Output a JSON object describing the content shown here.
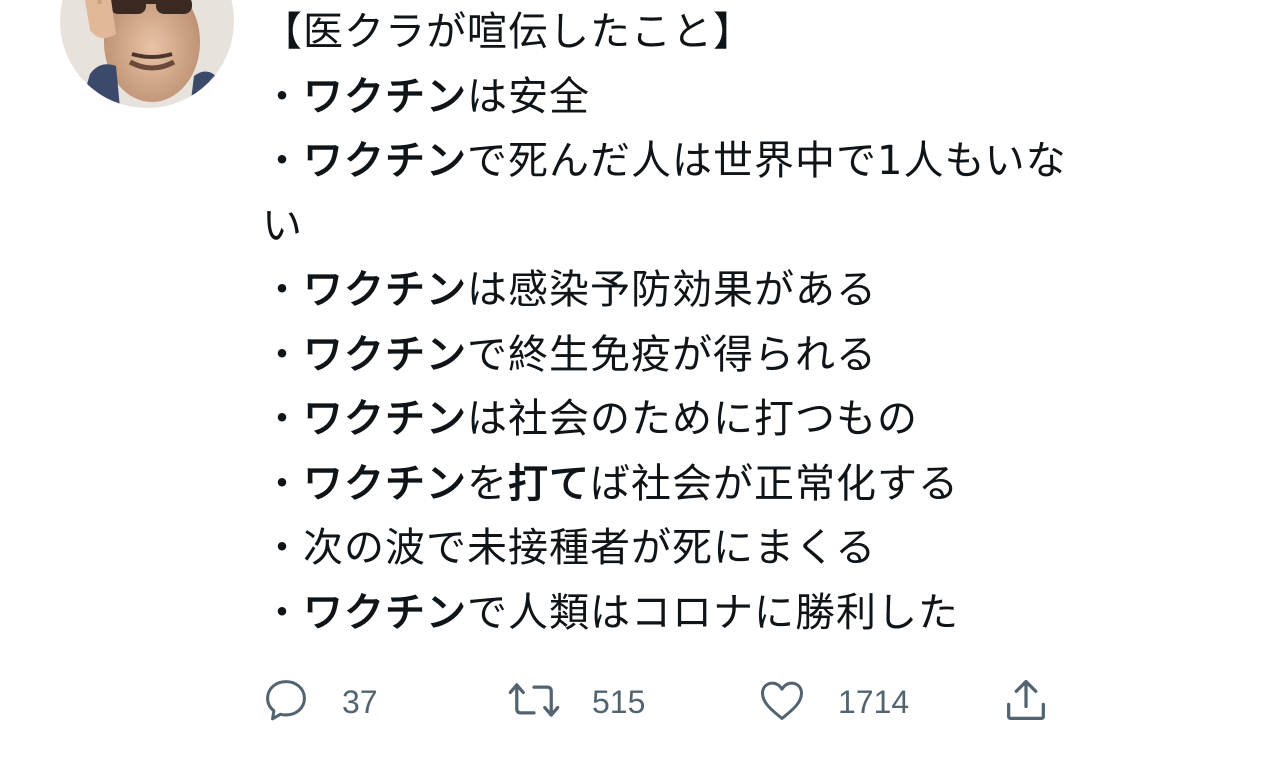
{
  "tweet": {
    "lines": [
      {
        "bullet": "",
        "bold": "",
        "text": "【医クラが喧伝したこと】"
      },
      {
        "bullet": "・",
        "bold": "ワクチン",
        "text": "は安全"
      },
      {
        "bullet": "・",
        "bold": "ワクチン",
        "text": "で死んだ人は世界中で1人もいな"
      },
      {
        "bullet": "",
        "bold": "",
        "text": "い"
      },
      {
        "bullet": "・",
        "bold": "ワクチン",
        "text": "は感染予防効果がある"
      },
      {
        "bullet": "・",
        "bold": "ワクチン",
        "text": "で終生免疫が得られる"
      },
      {
        "bullet": "・",
        "bold": "ワクチン",
        "text": "は社会のために打つもの"
      },
      {
        "bullet": "・",
        "bold": "ワクチン",
        "text": "を",
        "bold2": "打て",
        "text2": "ば社会が正常化する"
      },
      {
        "bullet": "・",
        "bold": "",
        "text": "次の波で未接種者が死にまくる"
      },
      {
        "bullet": "・",
        "bold": "ワクチン",
        "text": "で人類はコロナに勝利した"
      }
    ]
  },
  "actions": {
    "reply_count": "37",
    "retweet_count": "515",
    "like_count": "1714",
    "icons": {
      "reply": "reply-icon",
      "retweet": "retweet-icon",
      "like": "heart-icon",
      "share": "share-icon"
    },
    "icon_color": "#536471"
  }
}
